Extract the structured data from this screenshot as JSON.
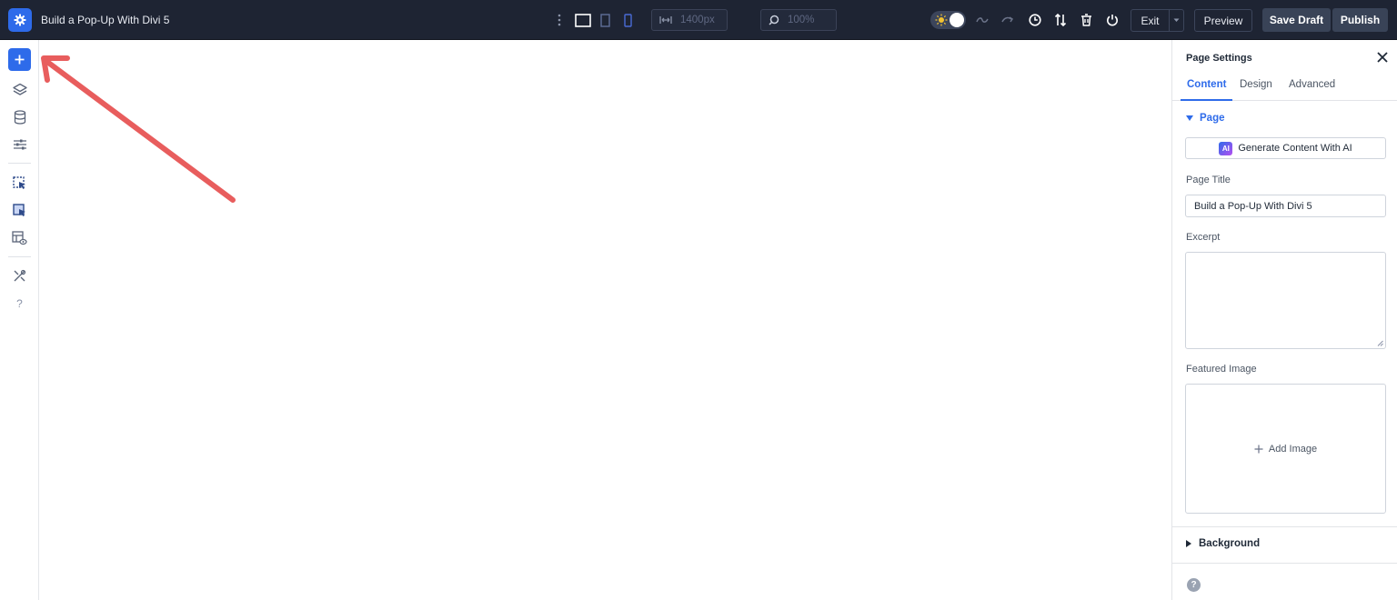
{
  "app": {
    "title": "Build a Pop-Up With Divi 5"
  },
  "toolbar": {
    "width_value": "1400px",
    "zoom_value": "100%",
    "exit_label": "Exit",
    "preview_label": "Preview",
    "save_draft_label": "Save Draft",
    "publish_label": "Publish"
  },
  "panel": {
    "title": "Page Settings",
    "tabs": [
      {
        "label": "Content"
      },
      {
        "label": "Design"
      },
      {
        "label": "Advanced"
      }
    ],
    "section_page": "Page",
    "generate_ai_label": "Generate Content With AI",
    "ai_badge": "AI",
    "page_title_label": "Page Title",
    "page_title_value": "Build a Pop-Up With Divi 5",
    "excerpt_label": "Excerpt",
    "featured_image_label": "Featured Image",
    "add_image_label": "Add Image",
    "background_label": "Background",
    "help_glyph": "?"
  },
  "rail": {
    "help_glyph": "?"
  },
  "colors": {
    "topbar_bg": "#1e2433",
    "accent": "#2e6bea",
    "annotation_arrow": "#e85d5d"
  }
}
